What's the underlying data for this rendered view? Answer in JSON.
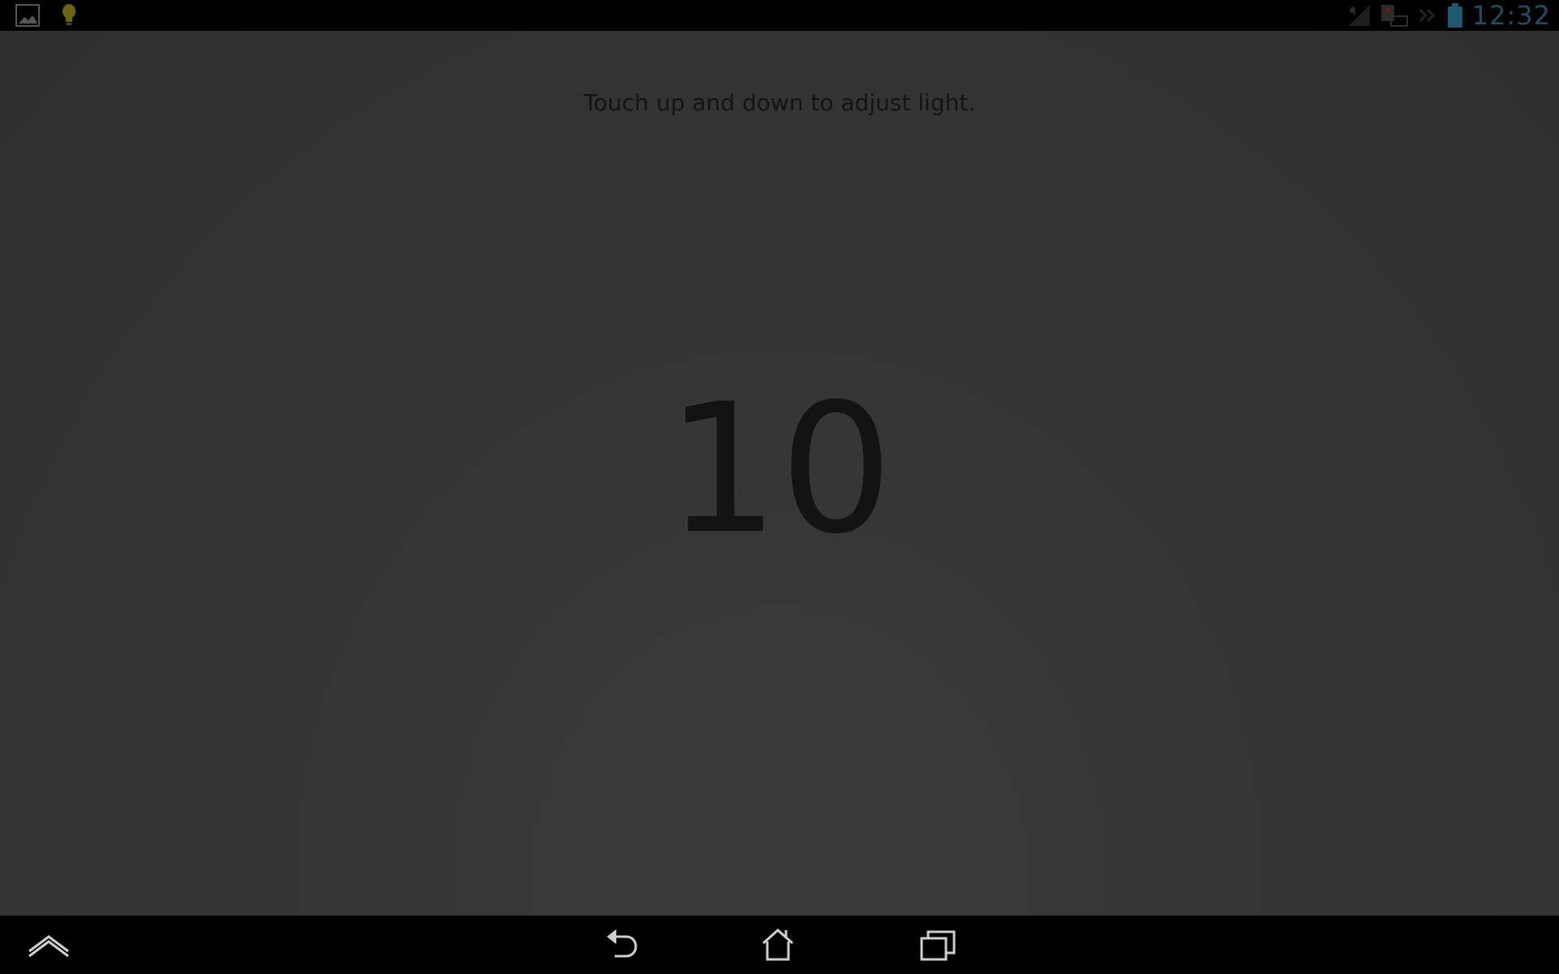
{
  "status_bar": {
    "clock": "12:32",
    "left_icons": [
      "gallery-icon",
      "lightbulb-icon"
    ],
    "right_icons": [
      "no-signal-icon",
      "sd-card-icon",
      "expand-icon",
      "battery-icon"
    ],
    "accent_colors": {
      "clock": "#1f4e63",
      "battery": "#1d5a72",
      "lightbulb": "#6b6510"
    }
  },
  "main": {
    "hint": "Touch up and down to adjust light.",
    "level": "10",
    "text_color": "#141414",
    "background_color": "#353535"
  },
  "nav_bar": {
    "buttons": [
      {
        "name": "menu-up-button",
        "icon": "chevron-up-icon"
      },
      {
        "name": "back-button",
        "icon": "back-arrow-icon"
      },
      {
        "name": "home-button",
        "icon": "home-icon"
      },
      {
        "name": "recent-apps-button",
        "icon": "recent-apps-icon"
      }
    ]
  }
}
